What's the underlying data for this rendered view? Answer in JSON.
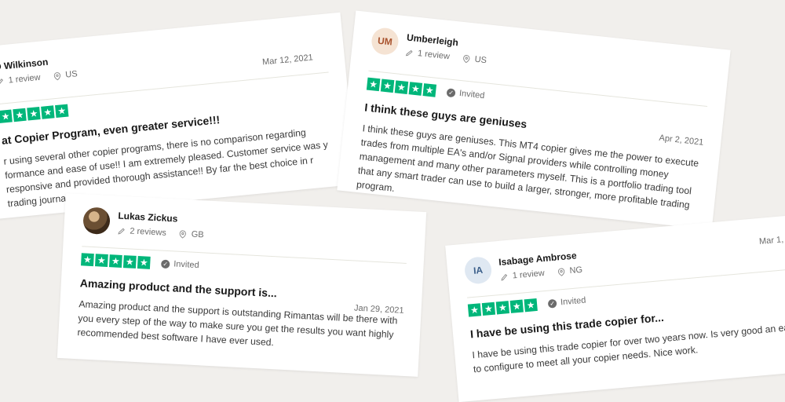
{
  "brand": {
    "star_color": "#00b67a"
  },
  "reviews": [
    {
      "name": "D Wilkinson",
      "reviews_count": "1 review",
      "country": "US",
      "date": "Mar 12, 2021",
      "invited": "",
      "title": "at Copier Program, even greater service!!!",
      "body": "r using several other copier programs, there is no comparison regarding formance and ease of use!! I am extremely pleased. Customer service was y responsive and provided thorough assistance!! By far the best choice in r trading journal!"
    },
    {
      "name": "Umberleigh",
      "initials": "UM",
      "reviews_count": "1 review",
      "country": "US",
      "date": "Apr 2, 2021",
      "invited": "Invited",
      "title": "I think these guys are geniuses",
      "body": "I think these guys are geniuses. This MT4 copier gives me the power to execute trades from multiple EA's and/or Signal providers while controlling money management and many other parameters myself. This is a portfolio trading tool that any smart trader can use to build a larger, stronger, more profitable trading program."
    },
    {
      "name": "Lukas Zickus",
      "reviews_count": "2 reviews",
      "country": "GB",
      "date": "Jan 29, 2021",
      "invited": "Invited",
      "title": "Amazing product and the support is...",
      "body": "Amazing product and the support is outstanding Rimantas will be there with you every step of the way to make sure you get the results you want highly recommended best software I have ever used."
    },
    {
      "name": "Isabage Ambrose",
      "initials": "IA",
      "reviews_count": "1 review",
      "country": "NG",
      "date": "Mar 1,",
      "invited": "Invited",
      "title": "I have be using this trade copier for...",
      "body": "I have be using this trade copier for over two years now. Is very good an easy to configure to meet all your copier needs. Nice work."
    }
  ]
}
